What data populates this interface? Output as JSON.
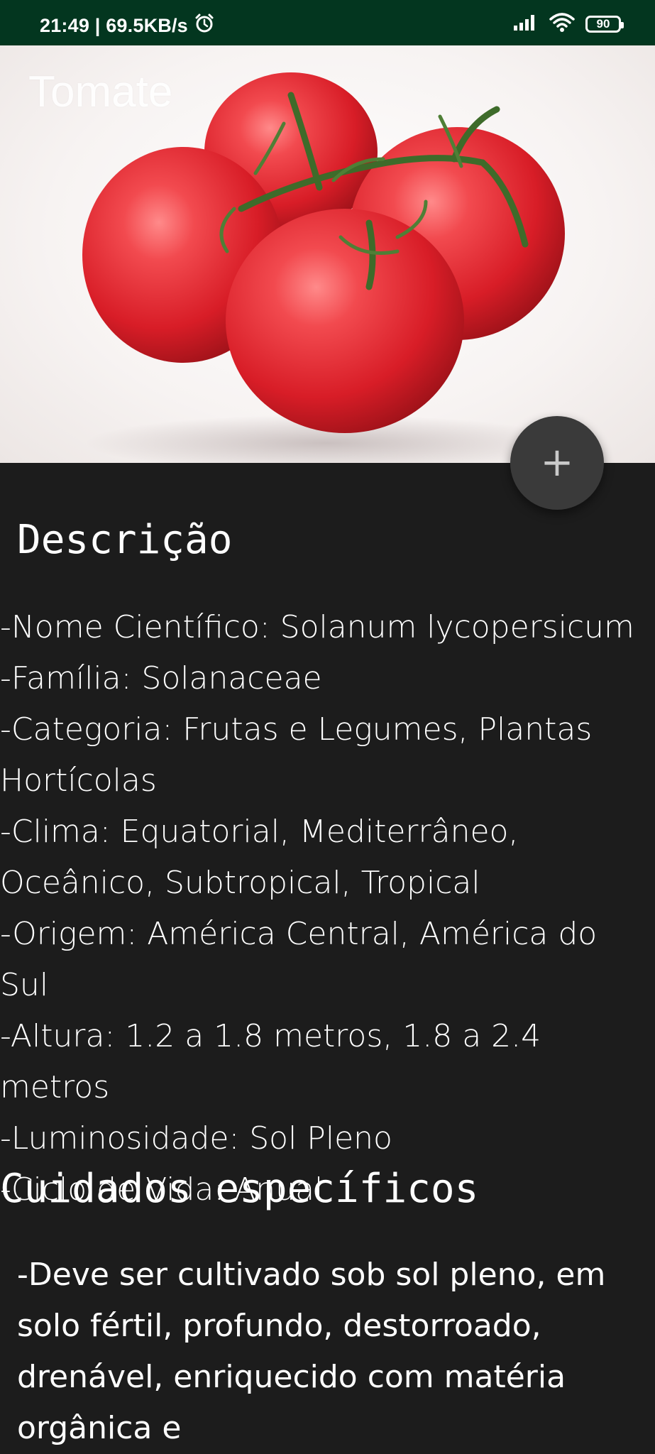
{
  "status_bar": {
    "time_speed": "21:49 | 69.5KB/s",
    "battery": "90",
    "icons": [
      "alarm-icon",
      "signal-icon",
      "wifi-icon",
      "battery-icon"
    ]
  },
  "toolbar": {
    "title": "Tomate"
  },
  "fab": {
    "icon": "plus-icon",
    "label": "+"
  },
  "description": {
    "title": "Descrição",
    "lines": [
      "-Nome Científico: Solanum lycopersicum",
      "-Família: Solanaceae",
      "-Categoria: Frutas e Legumes, Plantas Hortícolas",
      "-Clima: Equatorial, Mediterrâneo, Oceânico, Subtropical, Tropical",
      "-Origem: América Central, América do Sul",
      "-Altura: 1.2 a 1.8 metros, 1.8 a 2.4 metros",
      "-Luminosidade: Sol Pleno",
      "-Ciclo de Vida: Anual"
    ]
  },
  "care": {
    "title": "Cuidados específicos",
    "text": "-Deve ser cultivado sob sol pleno, em solo fértil, profundo, destorroado, drenável, enriquecido com matéria orgânica e"
  },
  "colors": {
    "status_bar": "#03361f",
    "background": "#1c1c1c",
    "fab": "#3a3a3a",
    "tomato": "#e3232c"
  }
}
